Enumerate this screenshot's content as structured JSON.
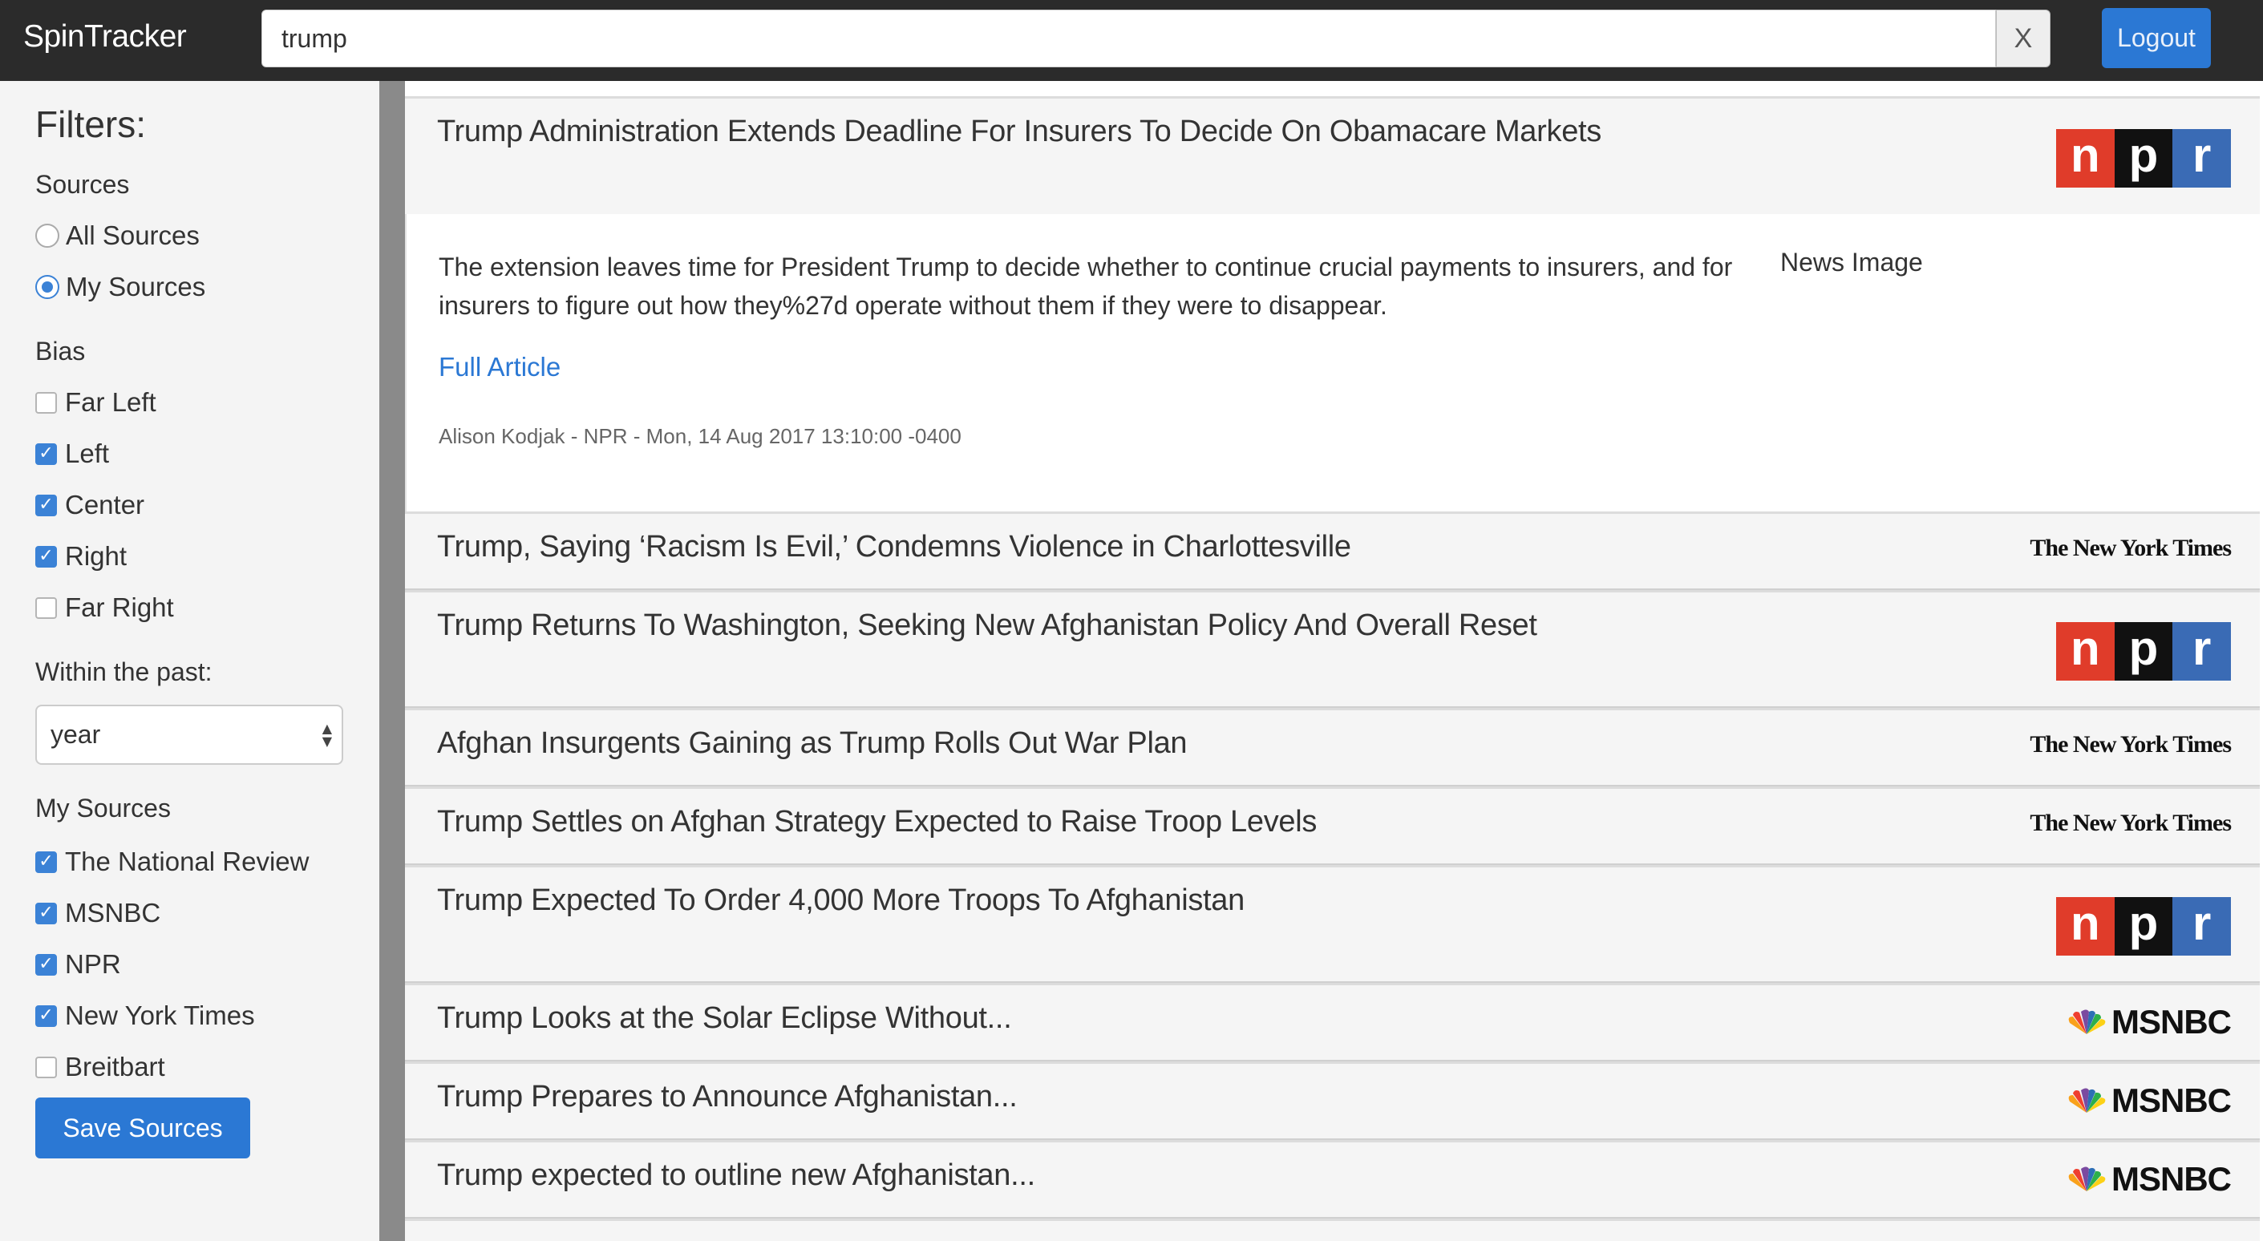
{
  "app": {
    "brand": "SpinTracker"
  },
  "search": {
    "value": "trump",
    "clear_label": "X"
  },
  "header": {
    "logout_label": "Logout"
  },
  "sidebar": {
    "title": "Filters:",
    "sources_label": "Sources",
    "source_options": [
      {
        "label": "All Sources",
        "selected": false
      },
      {
        "label": "My Sources",
        "selected": true
      }
    ],
    "bias_label": "Bias",
    "bias_options": [
      {
        "label": "Far Left",
        "checked": false
      },
      {
        "label": "Left",
        "checked": true
      },
      {
        "label": "Center",
        "checked": true
      },
      {
        "label": "Right",
        "checked": true
      },
      {
        "label": "Far Right",
        "checked": false
      }
    ],
    "within_label": "Within the past:",
    "within_value": "year",
    "my_sources_label": "My Sources",
    "my_sources": [
      {
        "label": "The National Review",
        "checked": true
      },
      {
        "label": "MSNBC",
        "checked": true
      },
      {
        "label": "NPR",
        "checked": true
      },
      {
        "label": "New York Times",
        "checked": true
      },
      {
        "label": "Breitbart",
        "checked": false
      }
    ],
    "save_label": "Save Sources"
  },
  "articles": [
    {
      "title": "Trump Administration Extends Deadline For Insurers To Decide On Obamacare Markets",
      "source_logo": "npr-logo"
    },
    {
      "title": "Trump, Saying ‘Racism Is Evil,’ Condemns Violence in Charlottesville",
      "source_logo": "nyt-logo"
    },
    {
      "title": "Trump Returns To Washington, Seeking New Afghanistan Policy And Overall Reset",
      "source_logo": "npr-logo"
    },
    {
      "title": "Afghan Insurgents Gaining as Trump Rolls Out War Plan",
      "source_logo": "nyt-logo"
    },
    {
      "title": "Trump Settles on Afghan Strategy Expected to Raise Troop Levels",
      "source_logo": "nyt-logo"
    },
    {
      "title": "Trump Expected To Order 4,000 More Troops To Afghanistan",
      "source_logo": "npr-logo"
    },
    {
      "title": "Trump Looks at the Solar Eclipse Without...",
      "source_logo": "msnbc-logo"
    },
    {
      "title": "Trump Prepares to Announce Afghanistan...",
      "source_logo": "msnbc-logo"
    },
    {
      "title": "Trump expected to outline new Afghanistan...",
      "source_logo": "msnbc-logo"
    }
  ],
  "expanded": {
    "description": "The extension leaves time for President Trump to decide whether to continue crucial payments to insurers, and for insurers to figure out how they%27d operate without them if they were to disappear.",
    "image_alt": "News Image",
    "link_label": "Full Article",
    "byline": "Alison Kodjak - NPR - Mon, 14 Aug 2017 13:10:00 -0400"
  },
  "logos": {
    "npr": {
      "n": "n",
      "p": "p",
      "r": "r"
    },
    "nyt": "The New York Times",
    "msnbc": "MSNBC"
  },
  "colors": {
    "accent": "#2b78d4",
    "navbar": "#2b2b2b",
    "sidebar": "#f4f4f4"
  }
}
